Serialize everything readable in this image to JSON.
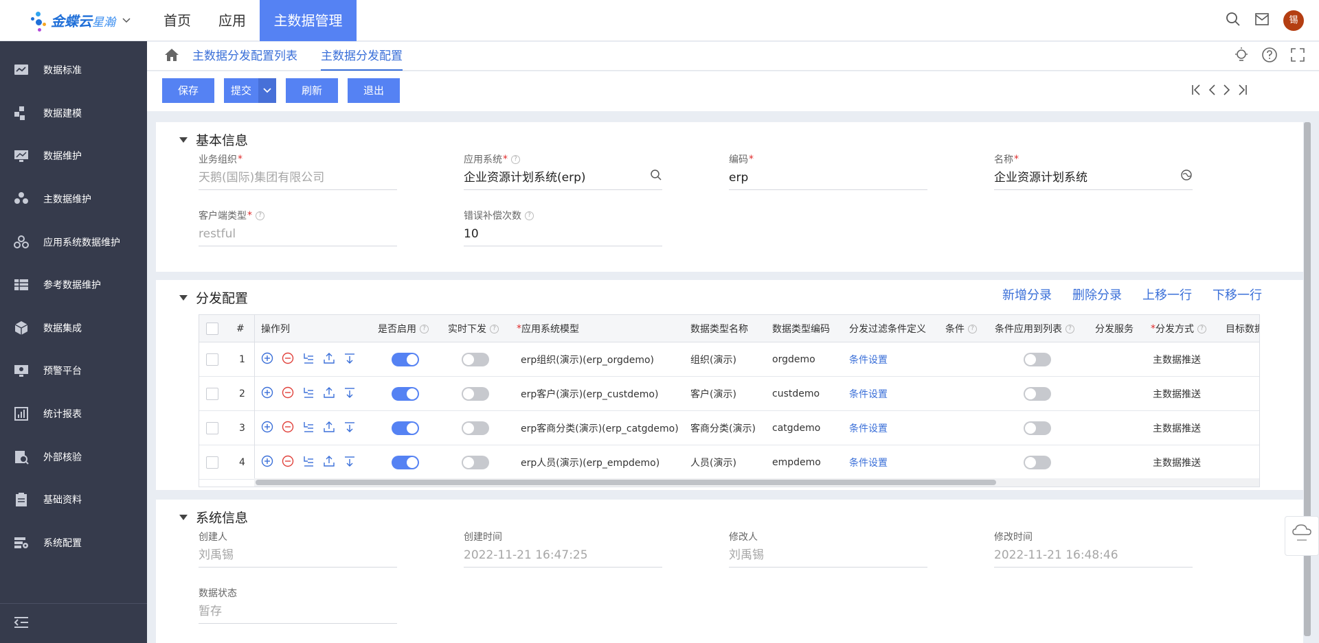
{
  "app": {
    "logo_main": "金蝶云",
    "logo_sub": "星瀚",
    "nav": [
      "首页",
      "应用",
      "主数据管理"
    ],
    "avatar_text": "锡"
  },
  "sidebar": {
    "items": [
      {
        "label": "数据标准",
        "icon": "chart-icon"
      },
      {
        "label": "数据建模",
        "icon": "modeling-icon"
      },
      {
        "label": "数据维护",
        "icon": "monitor-icon"
      },
      {
        "label": "主数据维护",
        "icon": "users-icon"
      },
      {
        "label": "应用系统数据维护",
        "icon": "nodes-icon"
      },
      {
        "label": "参考数据维护",
        "icon": "table-icon"
      },
      {
        "label": "数据集成",
        "icon": "cube-icon"
      },
      {
        "label": "预警平台",
        "icon": "alert-screen-icon"
      },
      {
        "label": "统计报表",
        "icon": "report-icon"
      },
      {
        "label": "外部核验",
        "icon": "verify-icon"
      },
      {
        "label": "基础资料",
        "icon": "clipboard-icon"
      },
      {
        "label": "系统配置",
        "icon": "settings-icon"
      }
    ]
  },
  "breadcrumb": {
    "items": [
      "主数据分发配置列表",
      "主数据分发配置"
    ]
  },
  "toolbar": {
    "save": "保存",
    "submit": "提交",
    "refresh": "刷新",
    "exit": "退出"
  },
  "basic": {
    "title": "基本信息",
    "business_org_label": "业务组织",
    "business_org_value": "天鹅(国际)集团有限公司",
    "app_system_label": "应用系统",
    "app_system_value": "企业资源计划系统(erp)",
    "code_label": "编码",
    "code_value": "erp",
    "name_label": "名称",
    "name_value": "企业资源计划系统",
    "client_type_label": "客户端类型",
    "client_type_value": "restful",
    "retry_label": "错误补偿次数",
    "retry_value": "10"
  },
  "dist": {
    "title": "分发配置",
    "actions": [
      "新增分录",
      "删除分录",
      "上移一行",
      "下移一行"
    ],
    "columns": [
      "#",
      "操作列",
      "是否启用",
      "实时下发",
      "应用系统模型",
      "数据类型名称",
      "数据类型编码",
      "分发过滤条件定义",
      "条件",
      "条件应用到列表",
      "分发服务",
      "分发方式",
      "目标数据"
    ],
    "rows": [
      {
        "no": "1",
        "enabled": true,
        "realtime": false,
        "model": "erp组织(演示)(erp_orgdemo)",
        "type_name": "组织(演示)",
        "type_code": "orgdemo",
        "filter": "条件设置",
        "apply": false,
        "mode": "主数据推送"
      },
      {
        "no": "2",
        "enabled": true,
        "realtime": false,
        "model": "erp客户(演示)(erp_custdemo)",
        "type_name": "客户(演示)",
        "type_code": "custdemo",
        "filter": "条件设置",
        "apply": false,
        "mode": "主数据推送"
      },
      {
        "no": "3",
        "enabled": true,
        "realtime": false,
        "model": "erp客商分类(演示)(erp_catgdemo)",
        "type_name": "客商分类(演示)",
        "type_code": "catgdemo",
        "filter": "条件设置",
        "apply": false,
        "mode": "主数据推送"
      },
      {
        "no": "4",
        "enabled": true,
        "realtime": false,
        "model": "erp人员(演示)(erp_empdemo)",
        "type_name": "人员(演示)",
        "type_code": "empdemo",
        "filter": "条件设置",
        "apply": false,
        "mode": "主数据推送"
      }
    ]
  },
  "sys": {
    "title": "系统信息",
    "creator_label": "创建人",
    "creator_value": "刘禹锡",
    "created_label": "创建时间",
    "created_value": "2022-11-21 16:47:25",
    "modifier_label": "修改人",
    "modifier_value": "刘禹锡",
    "modified_label": "修改时间",
    "modified_value": "2022-11-21 16:48:46",
    "status_label": "数据状态",
    "status_value": "暂存"
  },
  "colors": {
    "primary": "#5582f3",
    "sidebar_bg": "#363b4c",
    "link": "#3a6fd8",
    "required": "#e02b2b"
  }
}
